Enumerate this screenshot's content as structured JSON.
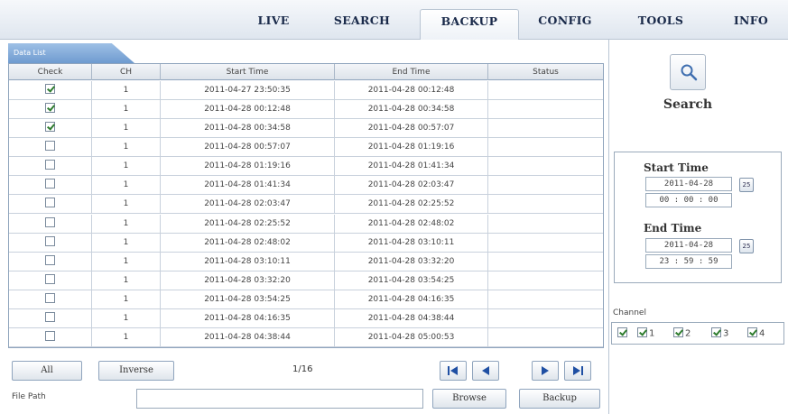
{
  "nav": {
    "tabs": [
      {
        "label": "LIVE"
      },
      {
        "label": "SEARCH"
      },
      {
        "label": "BACKUP",
        "active": true
      },
      {
        "label": "CONFIG"
      },
      {
        "label": "TOOLS"
      },
      {
        "label": "INFO"
      }
    ]
  },
  "data_list": {
    "tab_label": "Data List",
    "columns": [
      "Check",
      "CH",
      "Start Time",
      "End Time",
      "Status"
    ],
    "rows": [
      {
        "checked": true,
        "ch": "1",
        "start": "2011-04-27 23:50:35",
        "end": "2011-04-28 00:12:48",
        "status": ""
      },
      {
        "checked": true,
        "ch": "1",
        "start": "2011-04-28 00:12:48",
        "end": "2011-04-28 00:34:58",
        "status": ""
      },
      {
        "checked": true,
        "ch": "1",
        "start": "2011-04-28 00:34:58",
        "end": "2011-04-28 00:57:07",
        "status": ""
      },
      {
        "checked": false,
        "ch": "1",
        "start": "2011-04-28 00:57:07",
        "end": "2011-04-28 01:19:16",
        "status": ""
      },
      {
        "checked": false,
        "ch": "1",
        "start": "2011-04-28 01:19:16",
        "end": "2011-04-28 01:41:34",
        "status": ""
      },
      {
        "checked": false,
        "ch": "1",
        "start": "2011-04-28 01:41:34",
        "end": "2011-04-28 02:03:47",
        "status": ""
      },
      {
        "checked": false,
        "ch": "1",
        "start": "2011-04-28 02:03:47",
        "end": "2011-04-28 02:25:52",
        "status": ""
      },
      {
        "checked": false,
        "ch": "1",
        "start": "2011-04-28 02:25:52",
        "end": "2011-04-28 02:48:02",
        "status": ""
      },
      {
        "checked": false,
        "ch": "1",
        "start": "2011-04-28 02:48:02",
        "end": "2011-04-28 03:10:11",
        "status": ""
      },
      {
        "checked": false,
        "ch": "1",
        "start": "2011-04-28 03:10:11",
        "end": "2011-04-28 03:32:20",
        "status": ""
      },
      {
        "checked": false,
        "ch": "1",
        "start": "2011-04-28 03:32:20",
        "end": "2011-04-28 03:54:25",
        "status": ""
      },
      {
        "checked": false,
        "ch": "1",
        "start": "2011-04-28 03:54:25",
        "end": "2011-04-28 04:16:35",
        "status": ""
      },
      {
        "checked": false,
        "ch": "1",
        "start": "2011-04-28 04:16:35",
        "end": "2011-04-28 04:38:44",
        "status": ""
      },
      {
        "checked": false,
        "ch": "1",
        "start": "2011-04-28 04:38:44",
        "end": "2011-04-28 05:00:53",
        "status": ""
      }
    ]
  },
  "controls": {
    "all_label": "All",
    "inverse_label": "Inverse",
    "page_indicator": "1/16",
    "file_path_label": "File Path",
    "file_path_value": "",
    "browse_label": "Browse",
    "backup_label": "Backup"
  },
  "search_panel": {
    "search_label": "Search",
    "start_time_label": "Start Time",
    "start_date": "2011-04-28",
    "start_time": "00 : 00 : 00",
    "end_time_label": "End Time",
    "end_date": "2011-04-28",
    "end_time": "23 : 59 : 59",
    "calendar_icon_text": "25",
    "channel_label": "Channel",
    "channels": [
      {
        "label": "",
        "checked": true
      },
      {
        "label": "1",
        "checked": true
      },
      {
        "label": "2",
        "checked": true
      },
      {
        "label": "3",
        "checked": true
      },
      {
        "label": "4",
        "checked": true
      }
    ]
  },
  "colors": {
    "accent_tab": "#6f9bd0",
    "checkmark": "#2f7d2f",
    "nav_text": "#1a2a4a"
  }
}
